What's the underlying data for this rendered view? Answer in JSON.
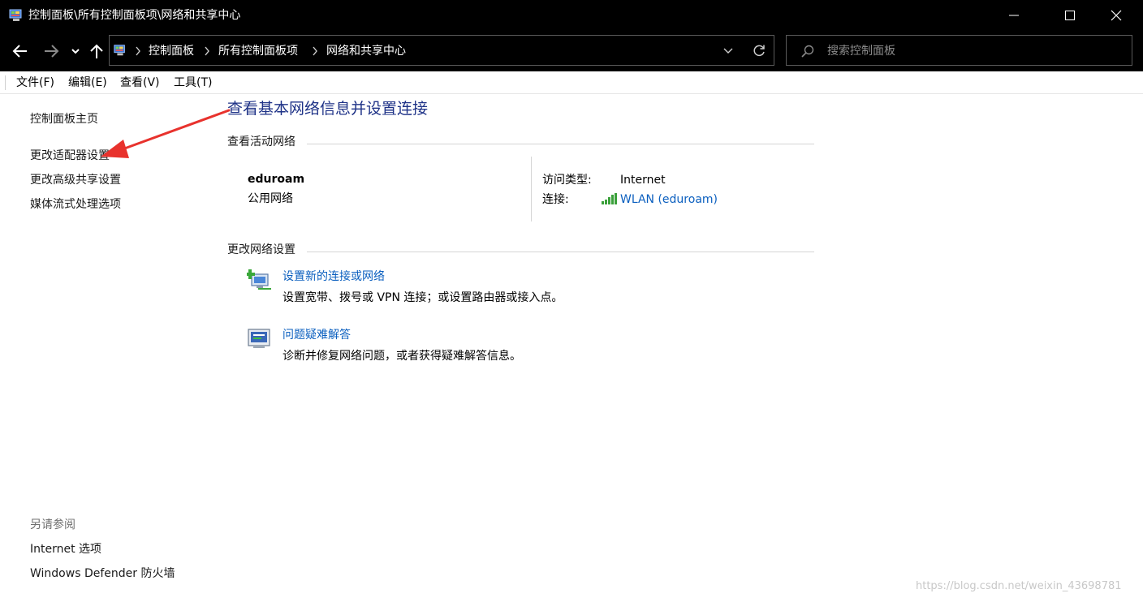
{
  "window": {
    "title": "控制面板\\所有控制面板项\\网络和共享中心",
    "app_icon": "control-panel-icon"
  },
  "address_bar": {
    "breadcrumbs": [
      "控制面板",
      "所有控制面板项",
      "网络和共享中心"
    ],
    "search_placeholder": "搜索控制面板"
  },
  "menu": {
    "items": [
      "文件(F)",
      "编辑(E)",
      "查看(V)",
      "工具(T)"
    ]
  },
  "sidebar": {
    "links": [
      "控制面板主页",
      "更改适配器设置",
      "更改高级共享设置",
      "媒体流式处理选项"
    ],
    "see_also_heading": "另请参阅",
    "see_also_links": [
      "Internet 选项",
      "Windows Defender 防火墙"
    ]
  },
  "main": {
    "title": "查看基本网络信息并设置连接",
    "active_networks": {
      "heading": "查看活动网络",
      "network_name": "eduroam",
      "network_category": "公用网络",
      "access_type_label": "访问类型:",
      "access_type_value": "Internet",
      "connection_label": "连接:",
      "connection_value": "WLAN (eduroam)"
    },
    "change_settings": {
      "heading": "更改网络设置",
      "tasks": [
        {
          "icon": "new-connection-icon",
          "link": "设置新的连接或网络",
          "description": "设置宽带、拨号或 VPN 连接；或设置路由器或接入点。"
        },
        {
          "icon": "troubleshoot-icon",
          "link": "问题疑难解答",
          "description": "诊断并修复网络问题，或者获得疑难解答信息。"
        }
      ]
    }
  },
  "colors": {
    "title_blue": "#1e3287",
    "link_blue": "#0b5fbf",
    "annotation_red": "#e8322d"
  },
  "watermark": "https://blog.csdn.net/weixin_43698781"
}
